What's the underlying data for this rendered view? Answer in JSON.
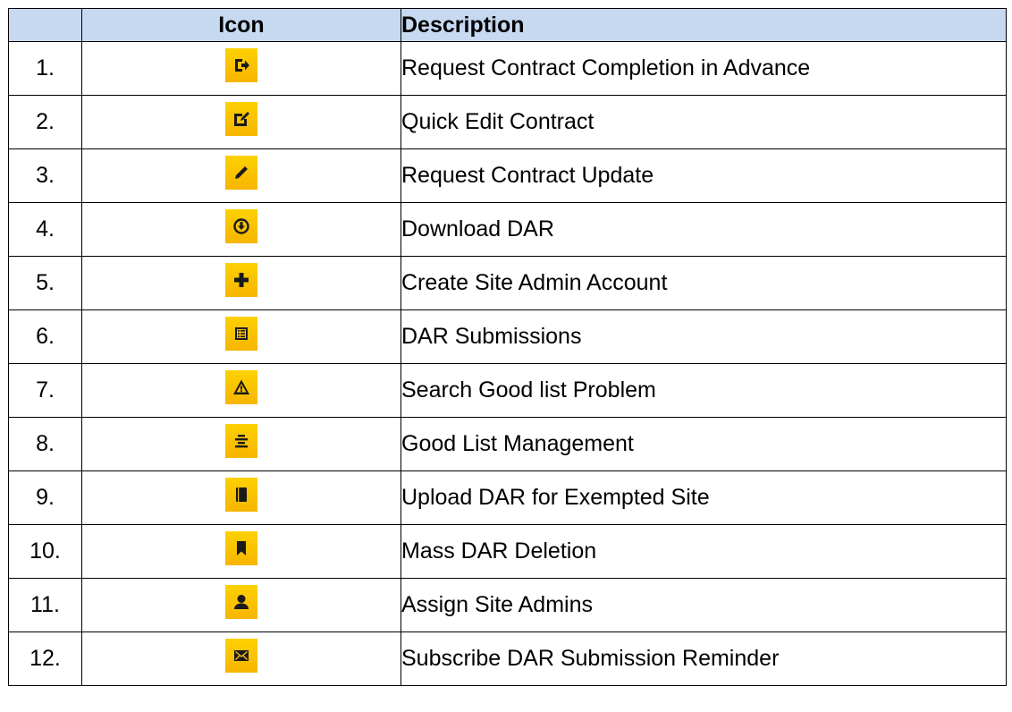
{
  "table": {
    "headers": {
      "number": "",
      "icon": "Icon",
      "description": "Description"
    },
    "rows": [
      {
        "number": "1.",
        "icon": "sign-out-icon",
        "description": "Request Contract Completion in Advance"
      },
      {
        "number": "2.",
        "icon": "edit-icon",
        "description": "Quick Edit Contract"
      },
      {
        "number": "3.",
        "icon": "pencil-icon",
        "description": "Request Contract Update"
      },
      {
        "number": "4.",
        "icon": "download-circle-icon",
        "description": "Download DAR"
      },
      {
        "number": "5.",
        "icon": "plus-icon",
        "description": "Create Site Admin Account"
      },
      {
        "number": "6.",
        "icon": "list-alt-icon",
        "description": "DAR Submissions"
      },
      {
        "number": "7.",
        "icon": "warning-icon",
        "description": "Search Good list Problem"
      },
      {
        "number": "8.",
        "icon": "align-center-icon",
        "description": "Good List Management"
      },
      {
        "number": "9.",
        "icon": "book-icon",
        "description": "Upload DAR for Exempted Site"
      },
      {
        "number": "10.",
        "icon": "bookmark-icon",
        "description": "Mass DAR Deletion"
      },
      {
        "number": "11.",
        "icon": "user-icon",
        "description": "Assign Site Admins"
      },
      {
        "number": "12.",
        "icon": "envelope-icon",
        "description": "Subscribe DAR Submission Reminder"
      }
    ]
  },
  "colors": {
    "header_background": "#c6d9f1",
    "icon_button_background": "#fcc20a",
    "icon_glyph": "#1a1a1a",
    "border": "#000000"
  }
}
